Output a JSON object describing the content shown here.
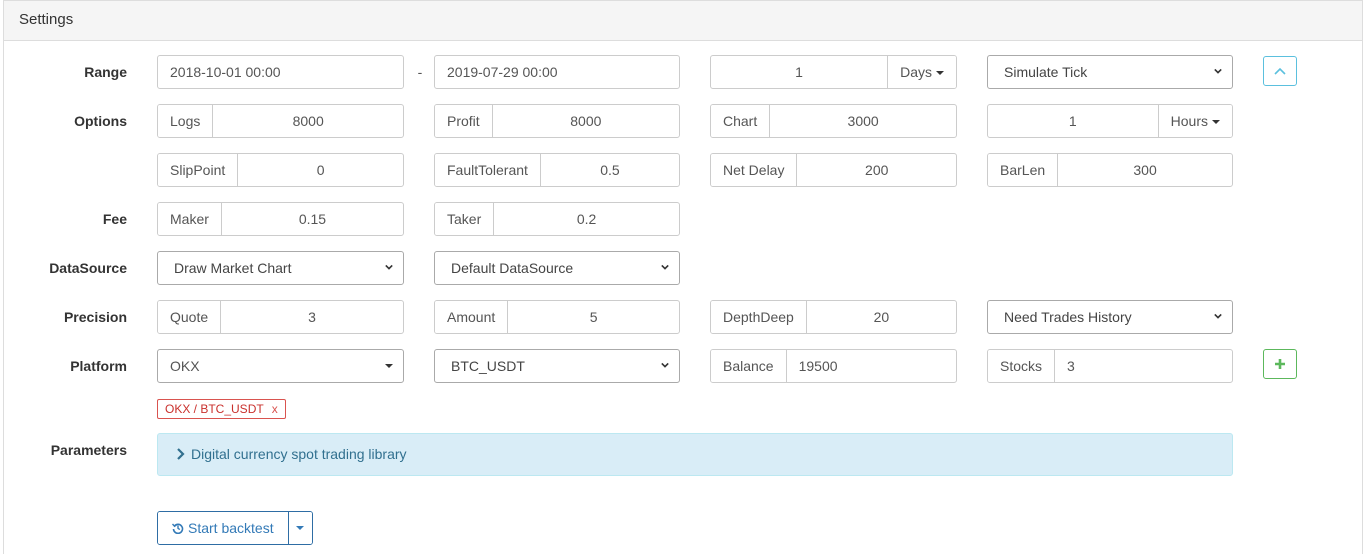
{
  "panel": {
    "title": "Settings"
  },
  "labels": {
    "range": "Range",
    "options": "Options",
    "fee": "Fee",
    "datasource": "DataSource",
    "precision": "Precision",
    "platform": "Platform",
    "parameters": "Parameters"
  },
  "range": {
    "start": "2018-10-01 00:00",
    "separator": "-",
    "end": "2019-07-29 00:00",
    "period_value": "1",
    "period_unit": "Days",
    "mode": "Simulate Tick"
  },
  "options": {
    "logs_label": "Logs",
    "logs_value": "8000",
    "profit_label": "Profit",
    "profit_value": "8000",
    "chart_label": "Chart",
    "chart_value": "3000",
    "kline_value": "1",
    "kline_unit": "Hours",
    "slippoint_label": "SlipPoint",
    "slippoint_value": "0",
    "faulttolerant_label": "FaultTolerant",
    "faulttolerant_value": "0.5",
    "netdelay_label": "Net Delay",
    "netdelay_value": "200",
    "barlen_label": "BarLen",
    "barlen_value": "300"
  },
  "fee": {
    "maker_label": "Maker",
    "maker_value": "0.15",
    "taker_label": "Taker",
    "taker_value": "0.2"
  },
  "datasource": {
    "chart_mode": "Draw Market Chart",
    "source": "Default DataSource"
  },
  "precision": {
    "quote_label": "Quote",
    "quote_value": "3",
    "amount_label": "Amount",
    "amount_value": "5",
    "depth_label": "DepthDeep",
    "depth_value": "20",
    "trades_history": "Need Trades History"
  },
  "platform": {
    "exchange": "OKX",
    "pair": "BTC_USDT",
    "balance_label": "Balance",
    "balance_value": "19500",
    "stocks_label": "Stocks",
    "stocks_value": "3",
    "tag_text": "OKX / BTC_USDT",
    "tag_remove": "x"
  },
  "parameters": {
    "library_title": "Digital currency spot trading library"
  },
  "actions": {
    "start_backtest": "Start backtest"
  },
  "colors": {
    "info_blue": "#5bc0de",
    "success_green": "#5cb85c",
    "danger_red": "#d9534f",
    "primary_blue": "#337ab7"
  }
}
